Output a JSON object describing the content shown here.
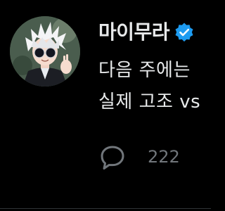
{
  "post": {
    "display_name": "마이무라",
    "verified": true,
    "text_line1": "다음 주에는",
    "text_line2": "실제 고조 vs",
    "reply_count": "222"
  },
  "icons": {
    "avatar": "anime-character-avatar",
    "verified": "verified-badge-icon",
    "reply": "reply-bubble-icon"
  },
  "colors": {
    "background": "#000000",
    "text": "#e7e9ea",
    "muted": "#71767b",
    "verified": "#1d9bf0"
  }
}
